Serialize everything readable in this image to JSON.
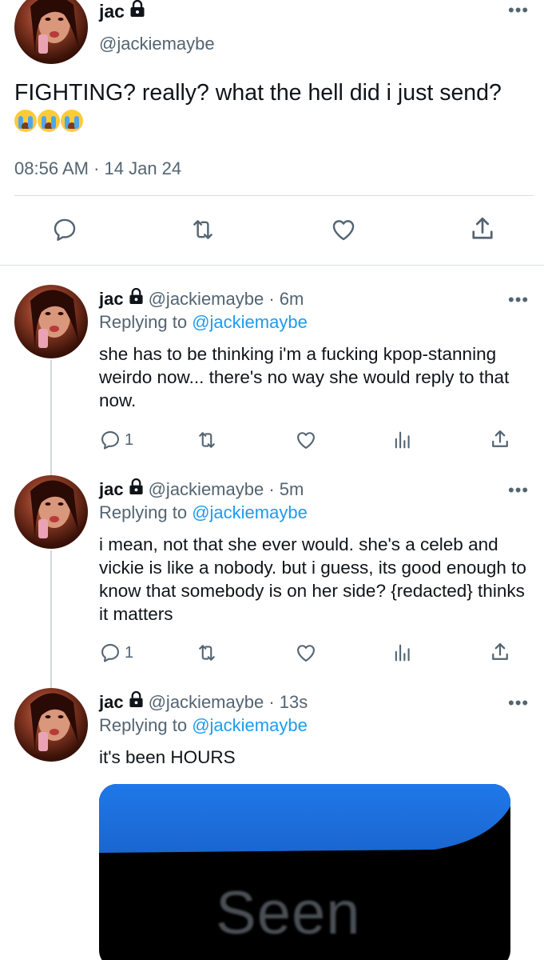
{
  "main_tweet": {
    "name": "jac",
    "handle": "@jackiemaybe",
    "text": "FIGHTING? really? what the hell did i just send?",
    "emoji": [
      "loudly-crying-face",
      "loudly-crying-face",
      "loudly-crying-face"
    ],
    "timestamp": "08:56 AM · 14 Jan 24",
    "more": "•••"
  },
  "replies": [
    {
      "name": "jac",
      "handle": "@jackiemaybe · 6m",
      "replying_prefix": "Replying to ",
      "replying_to": "@jackiemaybe",
      "text": "she has to be thinking i'm a fucking kpop-stanning weirdo now... there's no way she would reply to that now.",
      "reply_count": "1",
      "more": "•••"
    },
    {
      "name": "jac",
      "handle": "@jackiemaybe · 5m",
      "replying_prefix": "Replying to ",
      "replying_to": "@jackiemaybe",
      "text": "i mean, not that she ever would. she's a celeb and vickie is like a nobody. but i guess, its good enough to know that somebody is on her side? {redacted} thinks it matters",
      "reply_count": "1",
      "more": "•••"
    },
    {
      "name": "jac",
      "handle": "@jackiemaybe · 13s",
      "replying_prefix": "Replying to ",
      "replying_to": "@jackiemaybe",
      "text": "it's been HOURS",
      "more": "•••",
      "media_text": "Seen"
    }
  ],
  "icons": {
    "reply": "reply-icon",
    "retweet": "retweet-icon",
    "like": "heart-icon",
    "share": "share-icon",
    "analytics": "analytics-icon",
    "lock": "lock-icon"
  },
  "colors": {
    "link": "#1d9bf0",
    "secondary": "#536471",
    "text": "#0f1419",
    "divider": "#d9dee2",
    "media_blue": "#1f78e8"
  }
}
